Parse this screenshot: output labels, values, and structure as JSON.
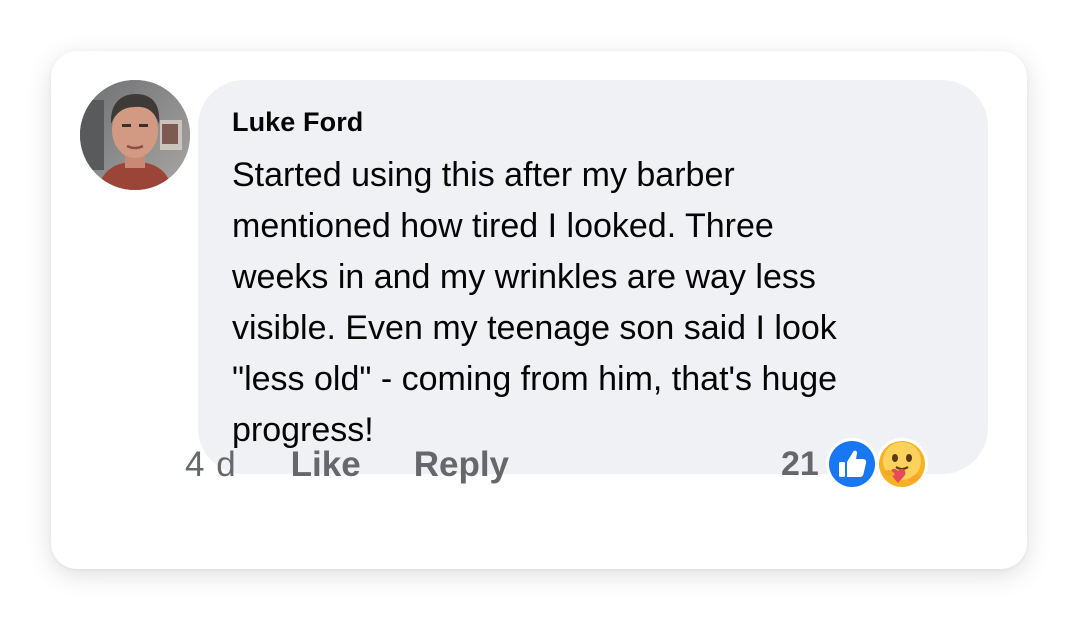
{
  "comment": {
    "author": "Luke Ford",
    "text": "Started using this after my barber\nmentioned how tired I looked. Three\nweeks in and my wrinkles are way less\nvisible. Even my teenage son said I look\n\"less old\" - coming from him, that's huge\nprogress!",
    "avatar_icon": "profile-photo",
    "bubble_color": "#f0f1f5"
  },
  "actions": {
    "time": "4 d",
    "like_label": "Like",
    "reply_label": "Reply"
  },
  "reactions": {
    "count": "21",
    "icons": [
      "like-reaction-icon",
      "care-reaction-icon"
    ],
    "like_color": "#1877f2"
  }
}
